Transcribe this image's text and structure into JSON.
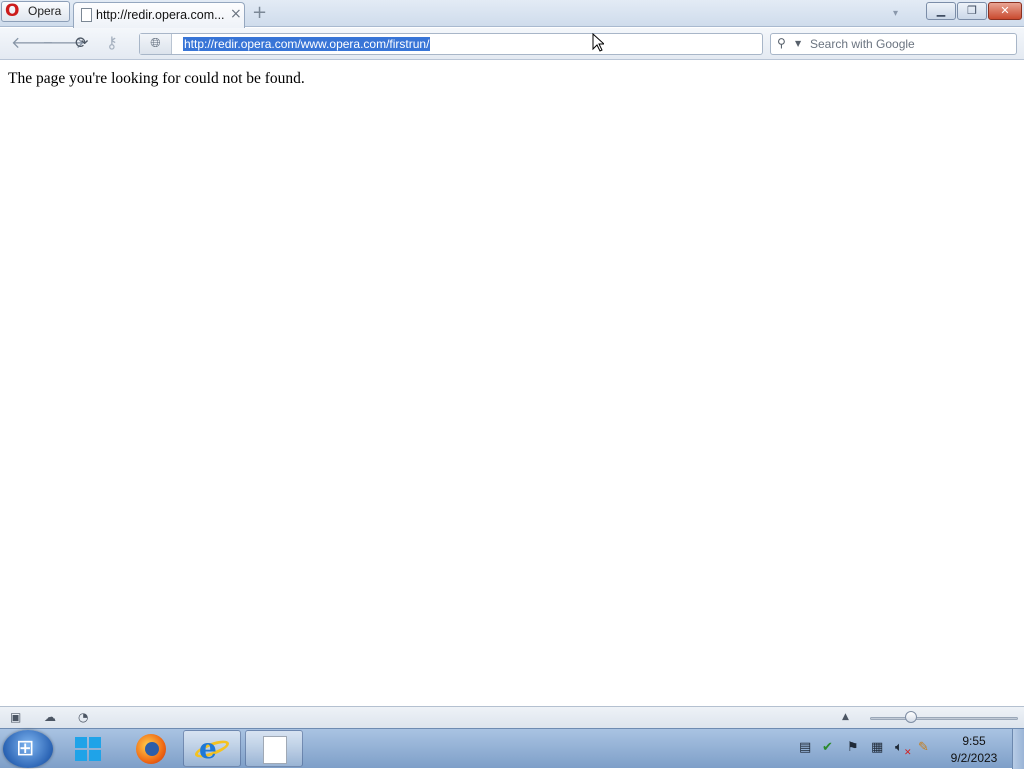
{
  "browser": {
    "menu_label": "Opera",
    "tab": {
      "title": "http://redir.opera.com...",
      "close_glyph": "×"
    },
    "new_tab_glyph": "+",
    "address": "http://redir.opera.com/www.opera.com/firstrun/",
    "search_placeholder": "Search with Google"
  },
  "page": {
    "message": "The page you're looking for could not be found."
  },
  "taskbar": {
    "clock_time": "9:55",
    "clock_date": "9/2/2023",
    "pinned": [
      "store-icon",
      "firefox-icon",
      "internet-explorer-icon",
      "file-icon"
    ]
  },
  "icons": {
    "back": "🡐",
    "forward": "🡒",
    "reload": "⟳",
    "wand": "⚷",
    "search": "⚲",
    "dropdown": "▼"
  },
  "colors": {
    "selection": "#3875d7",
    "close_button": "#c94a2f",
    "opera_red": "#cc1b1b"
  }
}
